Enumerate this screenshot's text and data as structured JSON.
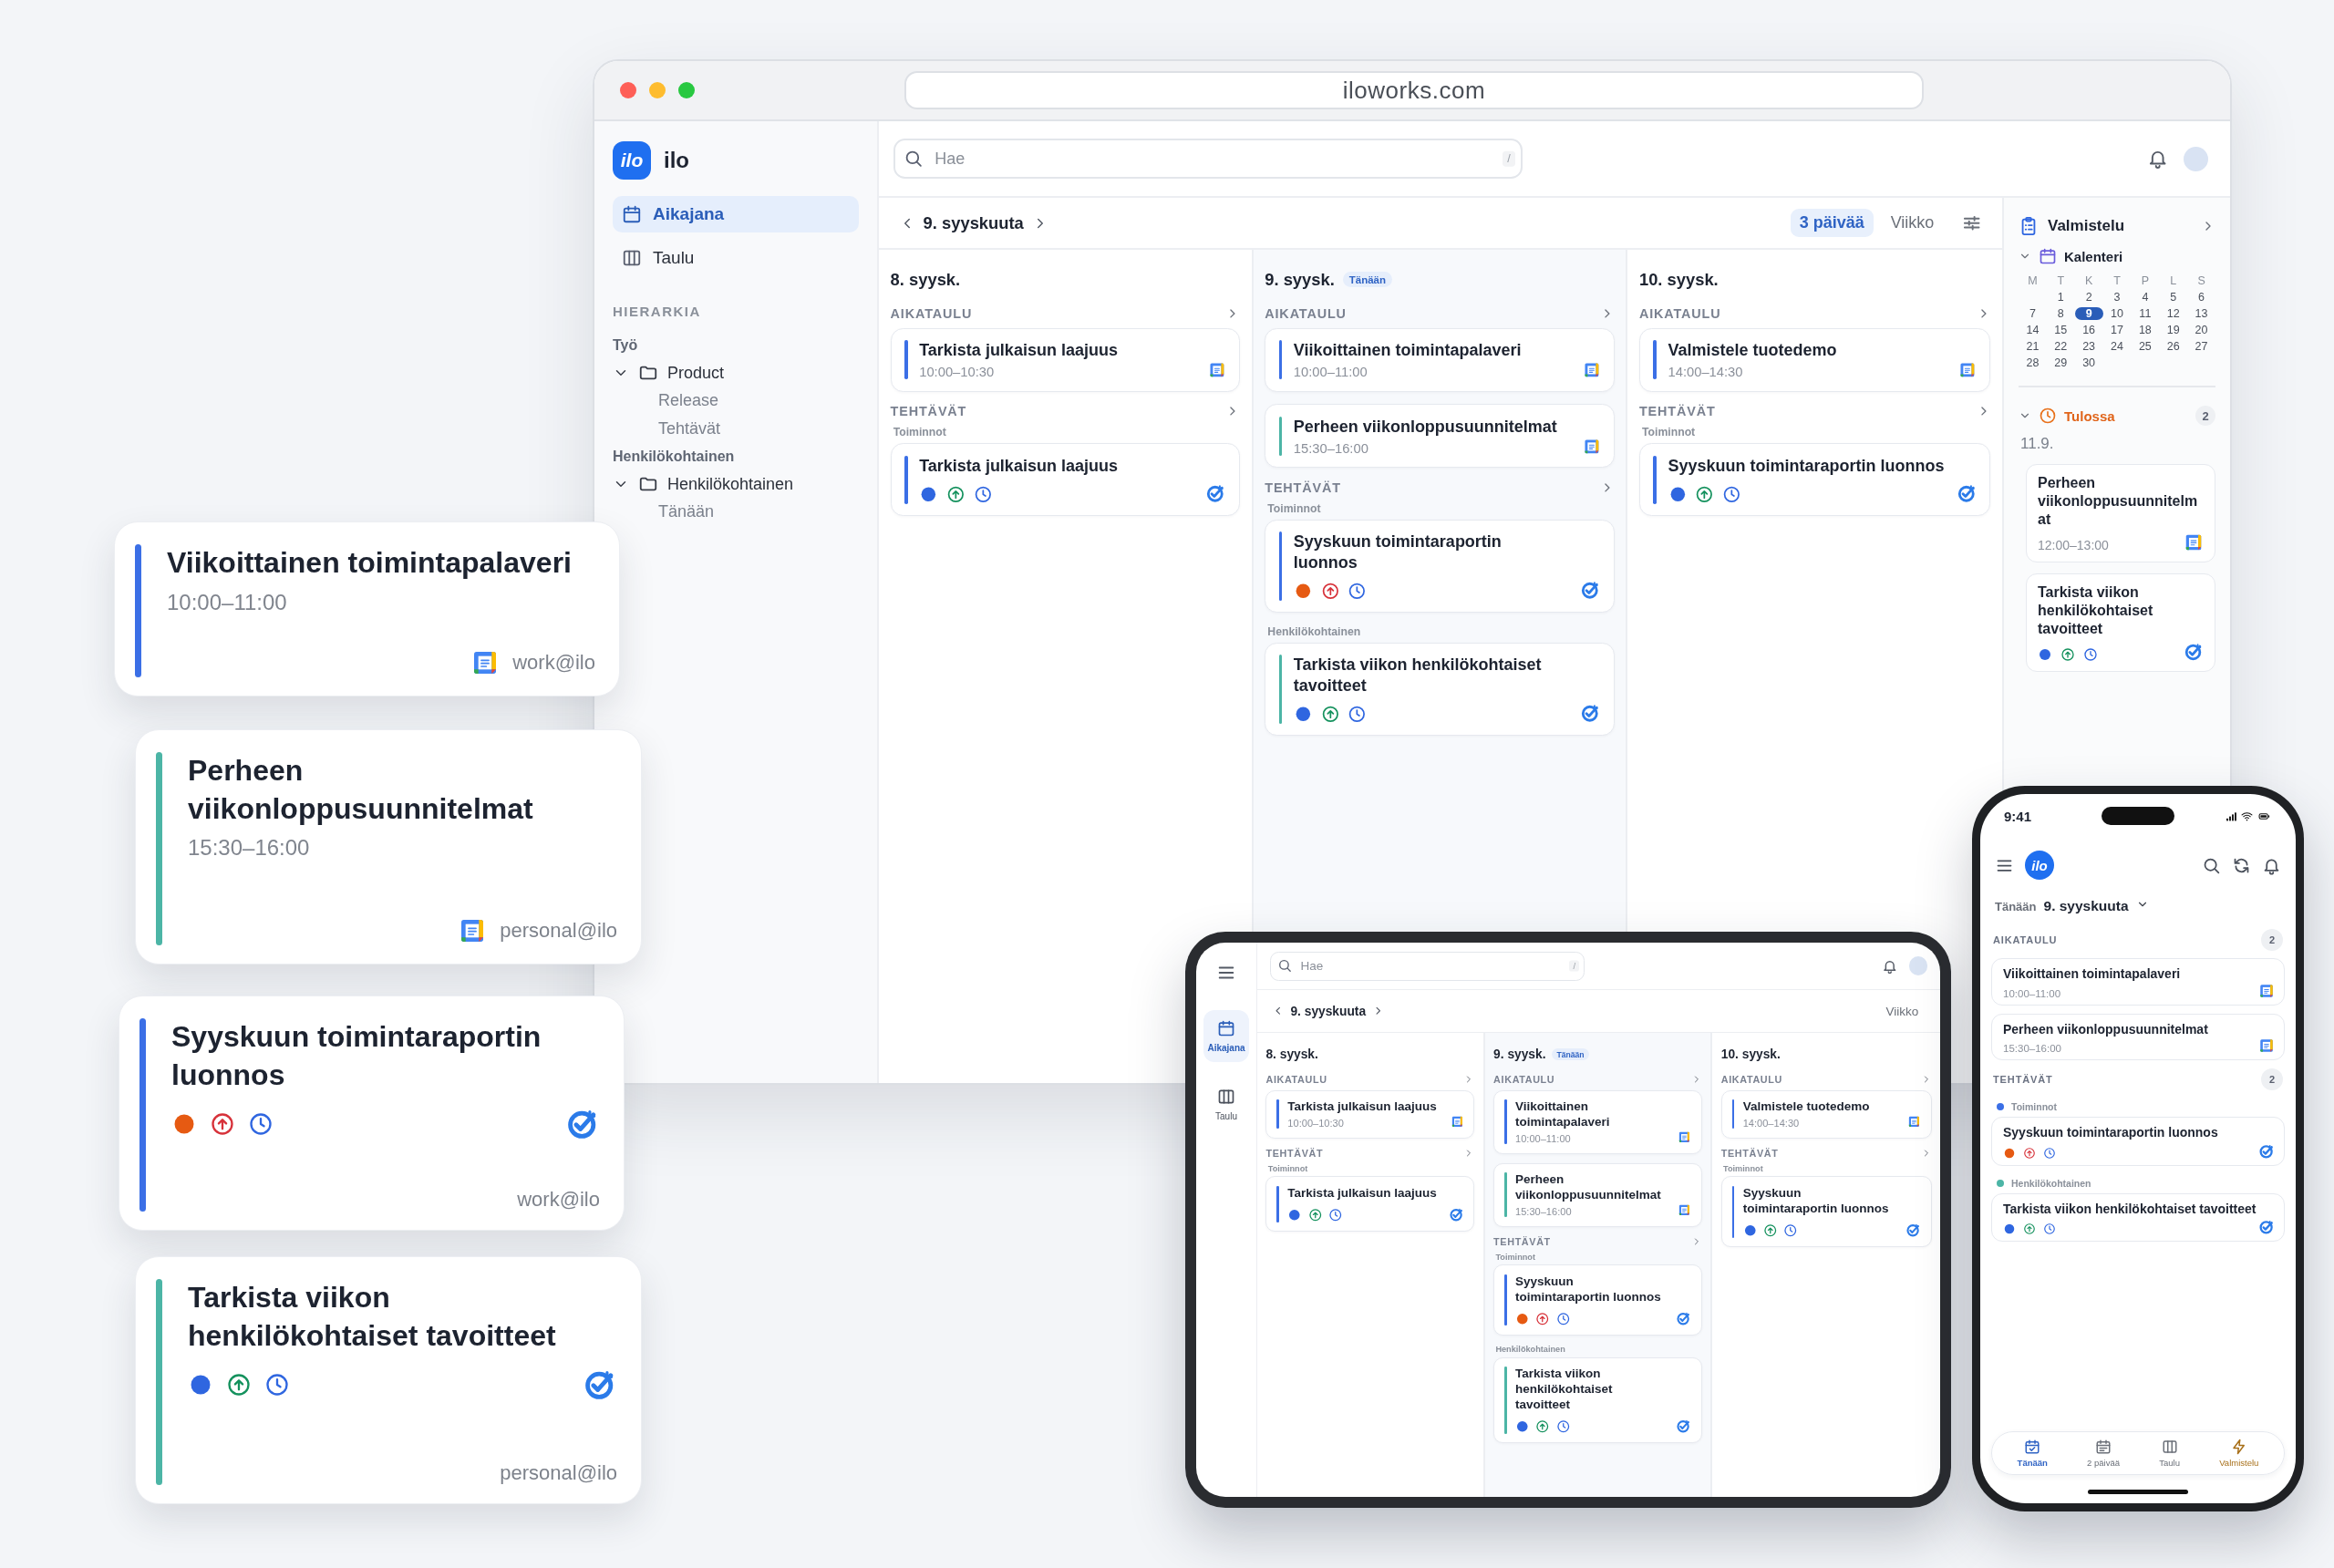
{
  "browser": {
    "url": "iloworks.com",
    "logo_text": "ilo",
    "app_name": "ilo",
    "nav": [
      {
        "label": "Aikajana",
        "selected": true
      },
      {
        "label": "Taulu",
        "selected": false
      }
    ],
    "hierarchy_title": "HIERARKIA",
    "tree": [
      {
        "label": "Työ",
        "children": [
          {
            "label": "Product",
            "expanded": true,
            "children": [
              {
                "label": "Release"
              },
              {
                "label": "Tehtävät"
              }
            ]
          }
        ]
      },
      {
        "label": "Henkilökohtainen",
        "children": [
          {
            "label": "Henkilökohtainen",
            "expanded": true,
            "children": [
              {
                "label": "Tänään"
              }
            ]
          }
        ]
      }
    ],
    "search": {
      "placeholder": "Hae",
      "shortcut": "/"
    },
    "date": "9. syyskuuta",
    "views": [
      {
        "label": "3 päivää",
        "selected": true
      },
      {
        "label": "Viikko",
        "selected": false
      }
    ],
    "days": [
      {
        "date": "8. syysk.",
        "schedule_title": "AIKATAULU",
        "events": [
          {
            "title": "Tarkista julkaisun laajuus",
            "time": "10:00–10:30",
            "color": "#3b6fe6"
          }
        ],
        "tasks_title": "TEHTÄVÄT",
        "task_groups": [
          {
            "label": "Toiminnot",
            "tasks": [
              {
                "title": "Tarkista julkaisun laajuus",
                "color": "#3b6fe6",
                "urgent": false
              }
            ]
          }
        ]
      },
      {
        "date": "9. syysk.",
        "badge": "Tänään",
        "schedule_title": "AIKATAULU",
        "events": [
          {
            "title": "Viikoittainen toimintapalaveri",
            "time": "10:00–11:00",
            "color": "#3b6fe6"
          },
          {
            "title": "Perheen viikonloppusuunnitelmat",
            "time": "15:30–16:00",
            "color": "#4cb5a6"
          }
        ],
        "tasks_title": "TEHTÄVÄT",
        "task_groups": [
          {
            "label": "Toiminnot",
            "tasks": [
              {
                "title": "Syyskuun toimintaraportin luonnos",
                "color": "#3b6fe6",
                "urgent": true
              }
            ]
          },
          {
            "label": "Henkilökohtainen",
            "tasks": [
              {
                "title": "Tarkista viikon henkilökohtaiset tavoitteet",
                "color": "#4cb5a6",
                "urgent": false
              }
            ]
          }
        ]
      },
      {
        "date": "10. syysk.",
        "schedule_title": "AIKATAULU",
        "events": [
          {
            "title": "Valmistele tuotedemo",
            "time": "14:00–14:30",
            "color": "#3b6fe6"
          }
        ],
        "tasks_title": "TEHTÄVÄT",
        "task_groups": [
          {
            "label": "Toiminnot",
            "tasks": [
              {
                "title": "Syyskuun toimintaraportin luonnos",
                "color": "#3b6fe6",
                "urgent": false
              }
            ]
          }
        ]
      }
    ],
    "side_panel": {
      "title": "Valmistelu",
      "calendar": {
        "title": "Kalenteri",
        "expanded": true,
        "weekdays": [
          "M",
          "T",
          "K",
          "T",
          "P",
          "L",
          "S"
        ],
        "days": [
          {
            "label": "1",
            "selected": false
          },
          {
            "label": "2",
            "selected": false
          },
          {
            "label": "3",
            "selected": false
          },
          {
            "label": "4",
            "selected": false
          },
          {
            "label": "5",
            "selected": false
          },
          {
            "label": "6",
            "selected": false
          },
          {
            "label": "7",
            "selected": false
          },
          {
            "label": "8",
            "selected": false
          },
          {
            "label": "9",
            "selected": true
          },
          {
            "label": "10",
            "selected": false
          },
          {
            "label": "11",
            "selected": false
          },
          {
            "label": "12",
            "selected": false
          },
          {
            "label": "13",
            "selected": false
          },
          {
            "label": "14",
            "selected": false
          },
          {
            "label": "15",
            "selected": false
          },
          {
            "label": "16",
            "selected": false
          },
          {
            "label": "17",
            "selected": false
          },
          {
            "label": "18",
            "selected": false
          },
          {
            "label": "19",
            "selected": false
          },
          {
            "label": "20",
            "selected": false
          },
          {
            "label": "21",
            "selected": false
          },
          {
            "label": "22",
            "selected": false
          },
          {
            "label": "23",
            "selected": false
          },
          {
            "label": "24",
            "selected": false
          },
          {
            "label": "25",
            "selected": false
          },
          {
            "label": "26",
            "selected": false
          },
          {
            "label": "27",
            "selected": false
          },
          {
            "label": "28",
            "selected": false
          },
          {
            "label": "29",
            "selected": false
          },
          {
            "label": "30",
            "selected": false
          }
        ]
      },
      "upcoming": {
        "title": "Tulossa",
        "expanded": true,
        "count": "2",
        "date": "11.9.",
        "items": [
          {
            "kind": "event",
            "title": "Perheen viikonloppusuunnitelmat",
            "time": "12:00–13:00"
          },
          {
            "kind": "task",
            "title": "Tarkista viikon henkilökohtaiset tavoitteet",
            "urgent": false
          }
        ]
      }
    }
  },
  "tablet": {
    "nav": [
      {
        "label": "Aikajana",
        "selected": true
      },
      {
        "label": "Taulu",
        "selected": false
      }
    ],
    "search": {
      "placeholder": "Hae",
      "shortcut": "/"
    },
    "date": "9. syyskuuta",
    "views": [
      {
        "label": "Viikko",
        "selected": false
      }
    ],
    "days": [
      {
        "date": "8. syysk.",
        "schedule_title": "AIKATAULU",
        "events": [
          {
            "title": "Tarkista julkaisun laajuus",
            "time": "10:00–10:30",
            "color": "#3b6fe6"
          }
        ],
        "tasks_title": "TEHTÄVÄT",
        "task_groups": [
          {
            "label": "Toiminnot",
            "tasks": [
              {
                "title": "Tarkista julkaisun laajuus",
                "color": "#3b6fe6",
                "urgent": false
              }
            ]
          }
        ]
      },
      {
        "date": "9. syysk.",
        "badge": "Tänään",
        "schedule_title": "AIKATAULU",
        "events": [
          {
            "title": "Viikoittainen toimintapalaveri",
            "time": "10:00–11:00",
            "color": "#3b6fe6"
          },
          {
            "title": "Perheen viikonloppusuunnitelmat",
            "time": "15:30–16:00",
            "color": "#4cb5a6"
          }
        ],
        "tasks_title": "TEHTÄVÄT",
        "task_groups": [
          {
            "label": "Toiminnot",
            "tasks": [
              {
                "title": "Syyskuun toimintaraportin luonnos",
                "color": "#3b6fe6",
                "urgent": true
              }
            ]
          },
          {
            "label": "Henkilökohtainen",
            "tasks": [
              {
                "title": "Tarkista viikon henkilökohtaiset tavoitteet",
                "color": "#4cb5a6",
                "urgent": false
              }
            ]
          }
        ]
      },
      {
        "date": "10. syysk.",
        "schedule_title": "AIKATAULU",
        "events": [
          {
            "title": "Valmistele tuotedemo",
            "time": "14:00–14:30",
            "color": "#3b6fe6"
          }
        ],
        "tasks_title": "TEHTÄVÄT",
        "task_groups": [
          {
            "label": "Toiminnot",
            "tasks": [
              {
                "title": "Syyskuun toimintaraportin luonnos",
                "color": "#3b6fe6",
                "urgent": false
              }
            ]
          }
        ]
      }
    ]
  },
  "phone": {
    "time": "9:41",
    "logo_text": "ilo",
    "today_label": "Tänään",
    "date": "9. syyskuuta",
    "schedule": {
      "title": "AIKATAULU",
      "count": "2",
      "events": [
        {
          "title": "Viikoittainen toimintapalaveri",
          "time": "10:00–11:00"
        },
        {
          "title": "Perheen viikonloppusuunnitelmat",
          "time": "15:30–16:00"
        }
      ]
    },
    "tasks": {
      "title": "TEHTÄVÄT",
      "count": "2",
      "groups": [
        {
          "label": "Toiminnot",
          "color": "#3b6fe6",
          "tasks": [
            {
              "title": "Syyskuun toimintaraportin luonnos",
              "urgent": true
            }
          ]
        },
        {
          "label": "Henkilökohtainen",
          "color": "#4cb5a6",
          "tasks": [
            {
              "title": "Tarkista viikon henkilökohtaiset tavoitteet",
              "urgent": false
            }
          ]
        }
      ]
    },
    "tabs": [
      {
        "label": "Tänään",
        "kind": "view",
        "selected": true
      },
      {
        "label": "2 päivää",
        "kind": "view",
        "selected": false
      },
      {
        "label": "Taulu",
        "kind": "view",
        "selected": false
      },
      {
        "label": "Valmistelu",
        "kind": "prep",
        "selected": false
      }
    ]
  },
  "floating_cards": [
    {
      "kind": "event",
      "title": "Viikoittainen toimintapalaveri",
      "time": "10:00–11:00",
      "account": "work@ilo",
      "color": "#3b6fe6"
    },
    {
      "kind": "event",
      "title": "Perheen viikonloppusuunnitelmat",
      "time": "15:30–16:00",
      "account": "personal@ilo",
      "color": "#4cb5a6"
    },
    {
      "kind": "task",
      "title": "Syyskuun toimintaraportin luonnos",
      "urgent": true,
      "account": "work@ilo",
      "color": "#3b6fe6"
    },
    {
      "kind": "task",
      "title": "Tarkista viikon henkilökohtaiset tavoitteet",
      "urgent": false,
      "account": "personal@ilo",
      "color": "#4cb5a6"
    }
  ]
}
